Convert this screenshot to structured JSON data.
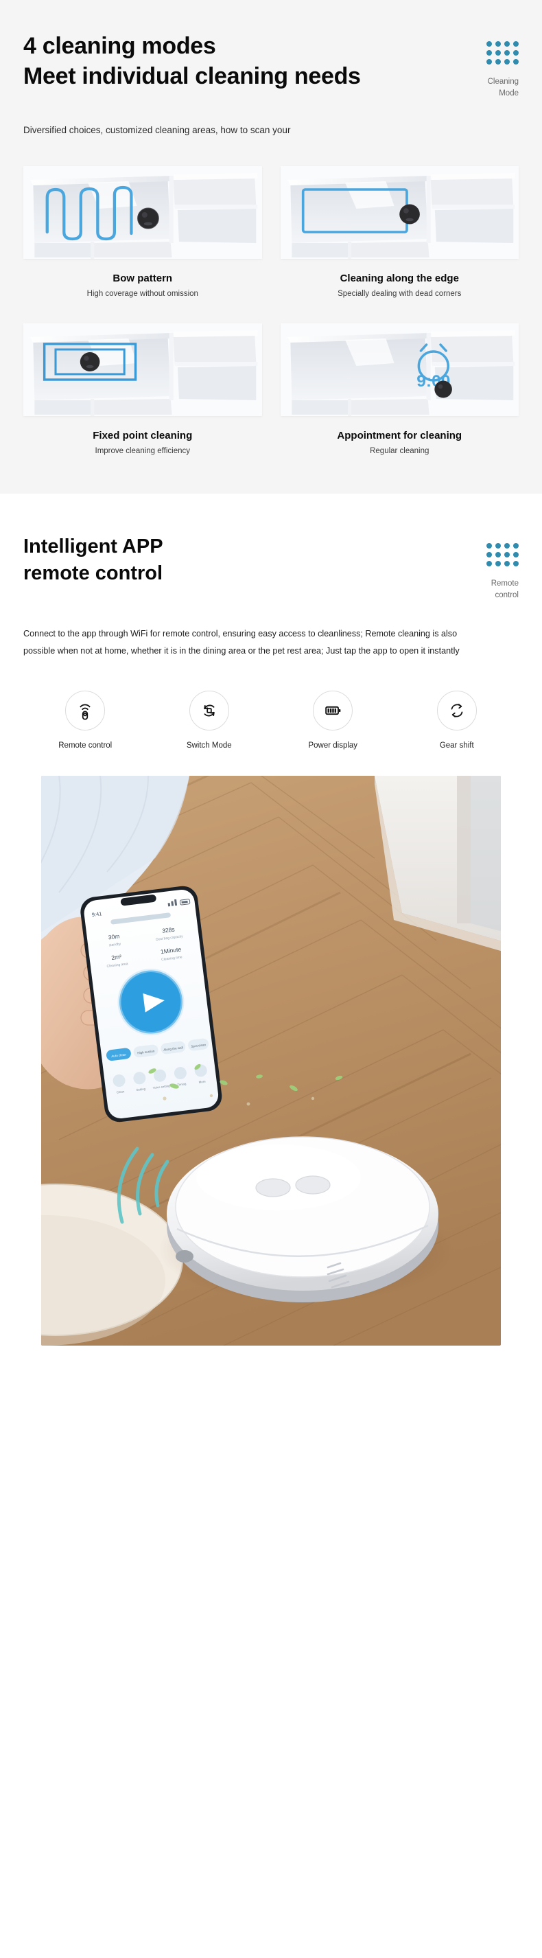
{
  "modes_section": {
    "heading": "4 cleaning modes\nMeet individual cleaning needs",
    "badge": {
      "label": "Cleaning\nMode",
      "dot_color": "#2f8cae",
      "dot_rows": 3,
      "dot_cols": 4
    },
    "subtitle": "Diversified choices, customized cleaning areas, how to scan your",
    "cards": [
      {
        "title": "Bow pattern",
        "desc": "High coverage without omission",
        "path_type": "serpentine",
        "accent": "#4aa6dd"
      },
      {
        "title": "Cleaning along the edge",
        "desc": "Specially dealing with dead corners",
        "path_type": "edge-loop",
        "accent": "#4aa6dd"
      },
      {
        "title": "Fixed point cleaning",
        "desc": "Improve cleaning efficiency",
        "path_type": "spot-square",
        "accent": "#3b9ad6"
      },
      {
        "title": "Appointment for cleaning",
        "desc": "Regular cleaning",
        "path_type": "clock",
        "accent": "#4aa6dd",
        "clock_time": "9:00"
      }
    ]
  },
  "app_section": {
    "heading": "Intelligent APP\nremote control",
    "badge": {
      "label": "Remote\ncontrol",
      "dot_color": "#2f8cae",
      "dot_rows": 3,
      "dot_cols": 4
    },
    "paragraph": "Connect to the app through WiFi for remote control, ensuring easy access to cleanliness; Remote cleaning is also possible when not at home, whether it is in the dining area or the pet rest area; Just tap the app to open it instantly",
    "features": [
      {
        "label": "Remote control",
        "icon": "remote-signal-icon"
      },
      {
        "label": "Switch Mode",
        "icon": "switch-mode-icon"
      },
      {
        "label": "Power display",
        "icon": "battery-icon"
      },
      {
        "label": "Gear shift",
        "icon": "gear-shift-icon"
      }
    ],
    "photo": {
      "alt": "Hand holding smartphone running the robot vacuum app over a wooden floor, white robot vacuum cleaning nearby",
      "phone_app": {
        "status_left": "9:41",
        "play_button": "play-icon",
        "stats": [
          {
            "value": "30m",
            "label": "standby"
          },
          {
            "value": "328s",
            "label": "Dust bag capacity"
          },
          {
            "value": "2m²",
            "label": "Cleaning area"
          },
          {
            "value": "1Minute",
            "label": "Cleaning time"
          }
        ],
        "controls": [
          "Auto clean",
          "High suction",
          "Along the wall",
          "Spot clean"
        ],
        "bottom_nav": [
          "Clean",
          "Setting",
          "Voice setting",
          "Timing",
          "More"
        ]
      }
    }
  }
}
